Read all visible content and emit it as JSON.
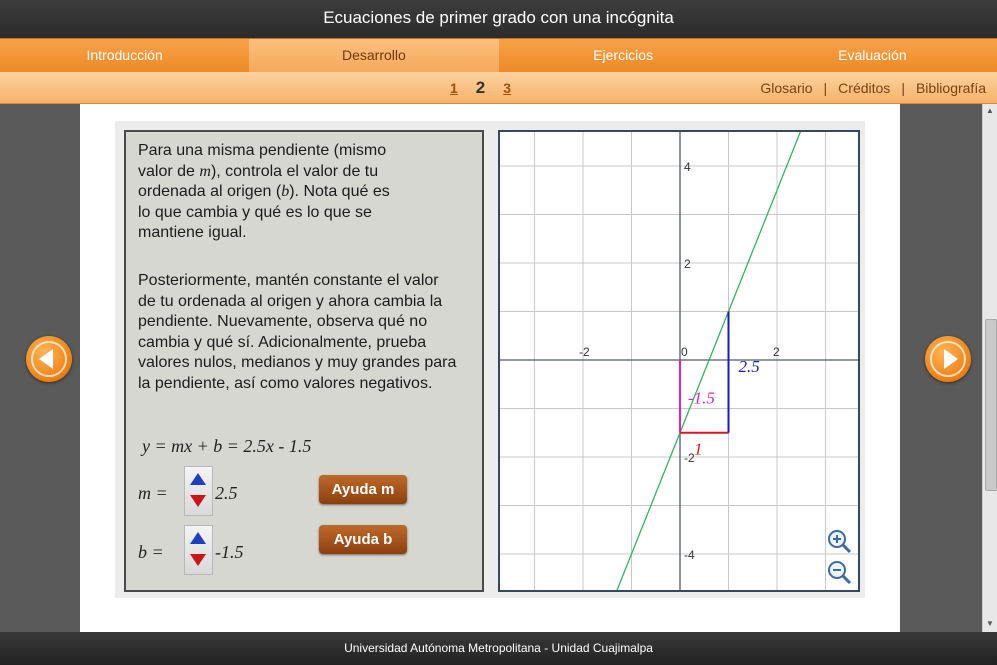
{
  "title": "Ecuaciones de primer grado con una incógnita",
  "tabs": [
    {
      "label": "Introducción"
    },
    {
      "label": "Desarrollo"
    },
    {
      "label": "Ejercicios"
    },
    {
      "label": "Evaluación"
    }
  ],
  "pages": [
    "1",
    "2",
    "3"
  ],
  "current_page": "2",
  "links": {
    "glosario": "Glosario",
    "creditos": "Créditos",
    "bibliografia": "Bibliografía",
    "separator": "|"
  },
  "text": {
    "p1_line1": "Para una misma pendiente (mismo",
    "p1_line2_a": "valor de ",
    "p1_line2_m": "m",
    "p1_line2_b": "), controla el valor de tu",
    "p1_line3_a": "ordenada al origen (",
    "p1_line3_b": "b",
    "p1_line3_c": "). Nota qué es",
    "p1_line4": "lo que cambia y qué es lo que se",
    "p1_line5": "mantiene igual.",
    "p2": "Posteriormente, mantén constante el valor de tu ordenada al origen y ahora cambia la pendiente. Nuevamente, observa qué no cambia y qué sí. Adicionalmente, prueba valores nulos, medianos y muy grandes para la pendiente, así como valores negativos."
  },
  "formula": "y = mx + b = 2.5x - 1.5",
  "controls": {
    "m_label": "m =",
    "m_value": "2.5",
    "b_label": "b =",
    "b_value": "-1.5",
    "help_m": "Ayuda m",
    "help_b": "Ayuda b"
  },
  "graph": {
    "slope": 2.5,
    "intercept": -1.5,
    "x_ticks": [
      "-2",
      "0",
      "2"
    ],
    "y_ticks": [
      "4",
      "2",
      "-2",
      "-4"
    ],
    "rise_label": "2.5",
    "intercept_label": "-1.5",
    "run_label": "1",
    "colors": {
      "line": "#2eb85c",
      "rise": "#1a1ac8",
      "run": "#e0141e",
      "intercept": "#e020c0",
      "grid": "#c8c8c8",
      "axis": "#505a64"
    }
  },
  "footer": "Universidad Autónoma Metropolitana - Unidad Cuajimalpa"
}
